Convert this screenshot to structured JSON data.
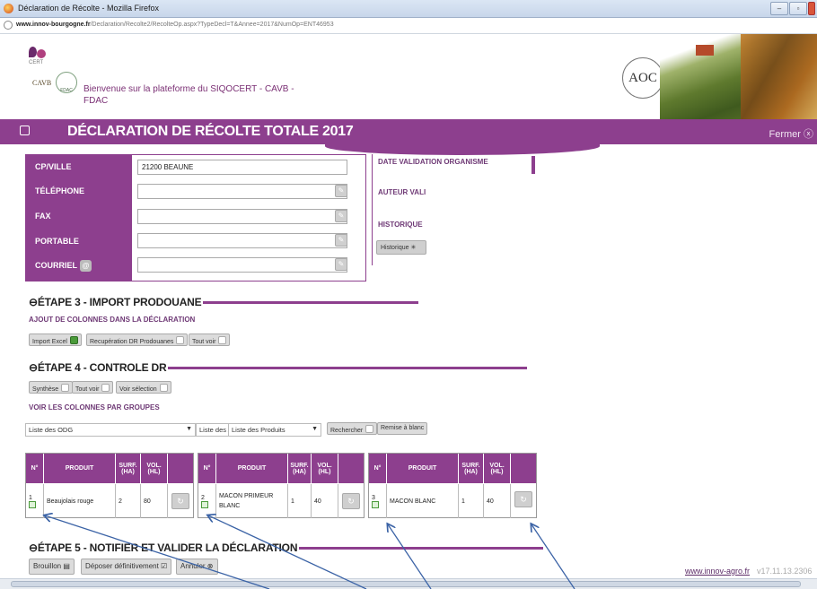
{
  "browser": {
    "window_title": "Déclaration de Récolte - Mozilla Firefox",
    "url_domain": "www.innov-bourgogne.fr",
    "url_path": "/Declaration/Recolte2/RecolteOp.aspx?TypeDecl=T&Annee=2017&NumOp=ENT46953"
  },
  "header": {
    "welcome_line1": "Bienvenue sur la plateforme du SIQOCERT - CAVB -",
    "welcome_line2": "FDAC",
    "logo_cavb": "CAVB",
    "logo_cert": "CERT",
    "logo_fdac": "FDAC",
    "logo_aoc": "AOC"
  },
  "page_title": "DÉCLARATION DE RÉCOLTE TOTALE 2017",
  "fermer": "Fermer",
  "form": {
    "cp_ville_label": "CP/VILLE",
    "cp_ville_value": "21200 BEAUNE",
    "telephone_label": "TÉLÉPHONE",
    "fax_label": "FAX",
    "portable_label": "PORTABLE",
    "courriel_label": "COURRIEL"
  },
  "right_panel": {
    "date_validation_label": "DATE VALIDATION ORGANISME",
    "auteur_label": "AUTEUR VALI",
    "historique_label": "HISTORIQUE",
    "historique_button": "Historique"
  },
  "step3": {
    "title": "ÉTAPE 3 - IMPORT PRODOUANE",
    "sublink": "AJOUT DE COLONNES DANS LA DÉCLARATION",
    "btn_import_excel": "Import Excel",
    "btn_recup_dr": "Recupération DR Prodouanes",
    "btn_tout_voir": "Tout voir"
  },
  "step4": {
    "title": "ÉTAPE 4 - CONTROLE DR",
    "btn_synthese": "Synthèse",
    "btn_tout_voir": "Tout voir",
    "btn_voir_selection": "Voir sélection",
    "sublink": "VOIR LES COLONNES PAR GROUPES",
    "select_odg": "Liste des ODG",
    "select_aoc": "Liste des AOC",
    "select_produits": "Liste des Produits",
    "btn_rechercher": "Rechercher",
    "btn_remise": "Remise à blanc"
  },
  "table_headers": {
    "num": "N°",
    "produit": "PRODUIT",
    "surf": "SURF. (HA)",
    "vol": "VOL. (HL)"
  },
  "rows": [
    {
      "num": "1",
      "produit": "Beaujolais rouge",
      "surf": "2",
      "vol": "80"
    },
    {
      "num": "2",
      "produit": "MACON PRIMEUR BLANC",
      "surf": "1",
      "vol": "40"
    },
    {
      "num": "3",
      "produit": "MACON BLANC",
      "surf": "1",
      "vol": "40"
    }
  ],
  "step5": {
    "title": "ÉTAPE 5 - NOTIFIER ET VALIDER LA DÉCLARATION",
    "btn_brouillon": "Brouillon",
    "btn_deposer": "Déposer définitivement",
    "btn_annuler": "Annuler"
  },
  "footer": {
    "link": "www.innov-agro.fr",
    "version": "v17.11.13.2306"
  },
  "colors": {
    "brand": "#8d3f8e",
    "arrow": "#3b63a6"
  }
}
